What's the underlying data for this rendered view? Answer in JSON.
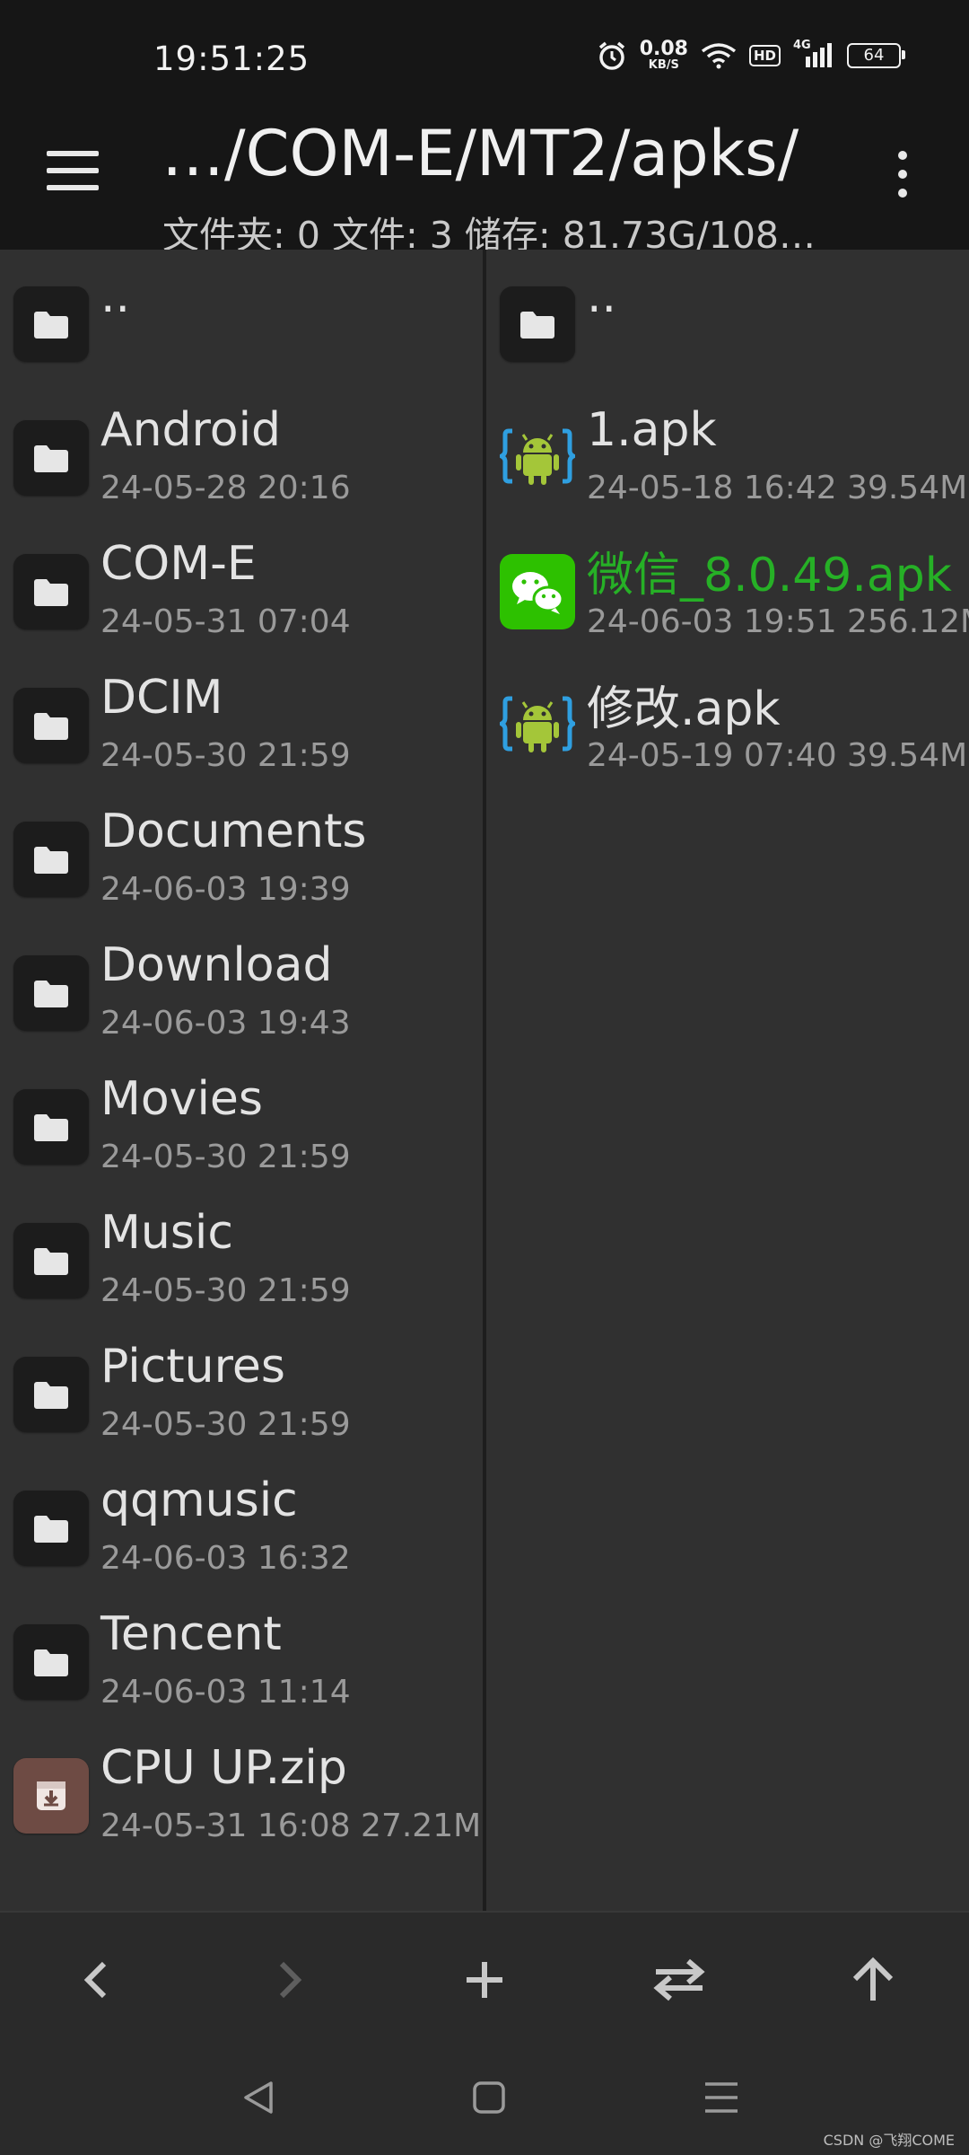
{
  "status_bar": {
    "time": "19:51:25",
    "net_speed": "0.08",
    "net_unit": "KB/S",
    "hd_label": "HD",
    "signal_label": "4G",
    "battery": "64"
  },
  "header": {
    "path": "…/COM-E/MT2/apks/",
    "stats": "文件夹: 0  文件: 3  储存: 81.73G/108…"
  },
  "left_pane": {
    "parent_label": "..",
    "items": [
      {
        "name": "Android",
        "meta": "24-05-28 20:16",
        "icon": "folder-icon"
      },
      {
        "name": "COM-E",
        "meta": "24-05-31 07:04",
        "icon": "folder-icon"
      },
      {
        "name": "DCIM",
        "meta": "24-05-30 21:59",
        "icon": "folder-icon"
      },
      {
        "name": "Documents",
        "meta": "24-06-03 19:39",
        "icon": "folder-icon"
      },
      {
        "name": "Download",
        "meta": "24-06-03 19:43",
        "icon": "folder-icon"
      },
      {
        "name": "Movies",
        "meta": "24-05-30 21:59",
        "icon": "folder-icon"
      },
      {
        "name": "Music",
        "meta": "24-05-30 21:59",
        "icon": "folder-icon"
      },
      {
        "name": "Pictures",
        "meta": "24-05-30 21:59",
        "icon": "folder-icon"
      },
      {
        "name": "qqmusic",
        "meta": "24-06-03 16:32",
        "icon": "folder-icon"
      },
      {
        "name": "Tencent",
        "meta": "24-06-03 11:14",
        "icon": "folder-icon"
      },
      {
        "name": "CPU UP.zip",
        "meta": "24-05-31 16:08  27.21M",
        "icon": "archive-icon"
      }
    ]
  },
  "right_pane": {
    "parent_label": "..",
    "items": [
      {
        "name": "1.apk",
        "meta": "24-05-18 16:42  39.54M",
        "icon": "android-apk-icon"
      },
      {
        "name": "微信_8.0.49.apk",
        "meta": "24-06-03 19:51  256.12M",
        "icon": "wechat-icon",
        "highlight": "#26b026"
      },
      {
        "name": "修改.apk",
        "meta": "24-05-19 07:40  39.54M",
        "icon": "android-apk-icon"
      }
    ]
  },
  "toolbar": {
    "buttons": [
      "back-icon",
      "forward-icon",
      "add-icon",
      "swap-icon",
      "up-icon"
    ]
  },
  "watermark": "CSDN @飞翔COME"
}
